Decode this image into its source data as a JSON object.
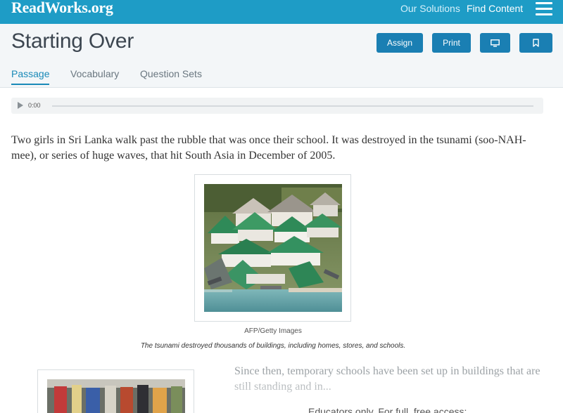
{
  "header": {
    "logo": "ReadWorks.org",
    "nav": [
      "Our Solutions",
      "Find Content"
    ]
  },
  "page": {
    "title": "Starting Over",
    "buttons": {
      "assign": "Assign",
      "print": "Print"
    },
    "tabs": [
      "Passage",
      "Vocabulary",
      "Question Sets"
    ],
    "active_tab": "Passage"
  },
  "audio": {
    "time": "0:00",
    "progress": 0
  },
  "passage": {
    "paragraph1": "Two girls in Sri Lanka walk past the rubble that was once their school. It was destroyed in the tsunami (soo-NAH-mee), or series of huge waves, that hit South Asia in December of 2005.",
    "figure": {
      "credit": "AFP/Getty Images",
      "caption": "The tsunami destroyed thousands of buildings, including homes, stores, and schools."
    },
    "paragraph2": "Since then, temporary schools have been set up in buildings that are still standing and in...",
    "educators_note": "Educators only. For full, free access:"
  },
  "colors": {
    "brand": "#1e9cc6",
    "button": "#1a7fb3",
    "active_tab": "#1a8ab8"
  },
  "icons": [
    "hamburger-menu-icon",
    "monitor-icon",
    "bookmark-icon",
    "play-icon"
  ]
}
